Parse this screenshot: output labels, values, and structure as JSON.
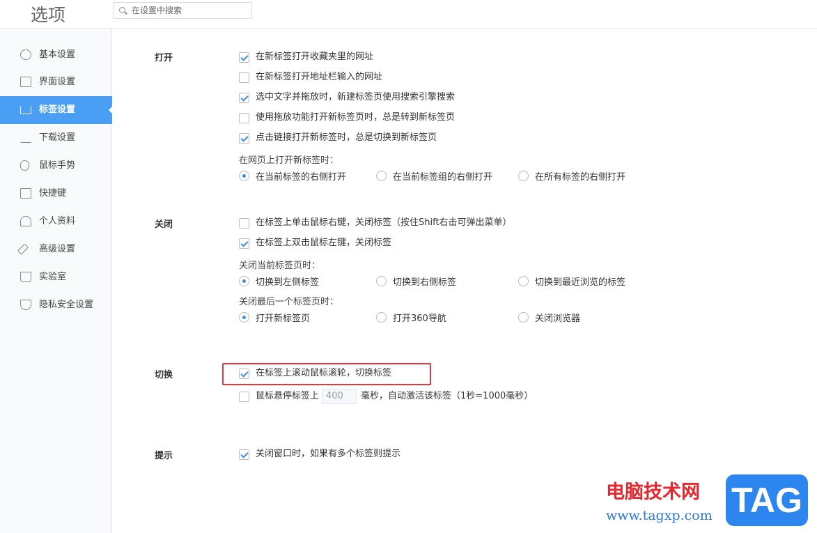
{
  "header": {
    "title": "选项",
    "search_placeholder": "在设置中搜索"
  },
  "sidebar": {
    "items": [
      {
        "label": "基本设置",
        "icon": "hexagon-gear-icon"
      },
      {
        "label": "界面设置",
        "icon": "window-icon"
      },
      {
        "label": "标签设置",
        "icon": "tab-icon",
        "active": true
      },
      {
        "label": "下载设置",
        "icon": "download-icon"
      },
      {
        "label": "鼠标手势",
        "icon": "mouse-icon"
      },
      {
        "label": "快捷键",
        "icon": "keyboard-icon"
      },
      {
        "label": "个人资料",
        "icon": "user-icon"
      },
      {
        "label": "高级设置",
        "icon": "wrench-icon"
      },
      {
        "label": "实验室",
        "icon": "flask-icon"
      },
      {
        "label": "隐私安全设置",
        "icon": "shield-icon"
      }
    ]
  },
  "open": {
    "title": "打开",
    "options": [
      {
        "label": "在新标签打开收藏夹里的网址",
        "checked": true
      },
      {
        "label": "在新标签打开地址栏输入的网址",
        "checked": false
      },
      {
        "label": "选中文字并拖放时，新建标签页使用搜索引擎搜索",
        "checked": true
      },
      {
        "label": "使用拖放功能打开新标签页时，总是转到新标签页",
        "checked": false
      },
      {
        "label": "点击链接打开新标签时，总是切换到新标签页",
        "checked": true
      }
    ],
    "new_tab_label": "在网页上打开新标签时：",
    "new_tab_radios": [
      {
        "label": "在当前标签的右侧打开",
        "selected": true
      },
      {
        "label": "在当前标签组的右侧打开",
        "selected": false
      },
      {
        "label": "在所有标签的右侧打开",
        "selected": false
      }
    ]
  },
  "close": {
    "title": "关闭",
    "options": [
      {
        "label": "在标签上单击鼠标右键，关闭标签（按住Shift右击可弹出菜单）",
        "checked": false
      },
      {
        "label": "在标签上双击鼠标左键，关闭标签",
        "checked": true
      }
    ],
    "current_label": "关闭当前标签页时：",
    "current_radios": [
      {
        "label": "切换到左侧标签",
        "selected": true
      },
      {
        "label": "切换到右侧标签",
        "selected": false
      },
      {
        "label": "切换到最近浏览的标签",
        "selected": false
      }
    ],
    "last_label": "关闭最后一个标签页时：",
    "last_radios": [
      {
        "label": "打开新标签页",
        "selected": true
      },
      {
        "label": "打开360导航",
        "selected": false
      },
      {
        "label": "关闭浏览器",
        "selected": false
      }
    ]
  },
  "switch": {
    "title": "切换",
    "scroll": {
      "label": "在标签上滚动鼠标滚轮，切换标签",
      "checked": true
    },
    "hover": {
      "label_before": "鼠标悬停标签上",
      "value": "400",
      "label_after": "毫秒，自动激活该标签（1秒=1000毫秒）",
      "checked": false
    }
  },
  "hint": {
    "title": "提示",
    "option": {
      "label": "关闭窗口时，如果有多个标签则提示",
      "checked": true
    }
  },
  "watermark": {
    "site_name": "电脑技术网",
    "url": "www.tagxp.com",
    "logo": "TAG"
  },
  "colors": {
    "accent": "#4a9ff5",
    "highlight": "#e03a3a"
  }
}
